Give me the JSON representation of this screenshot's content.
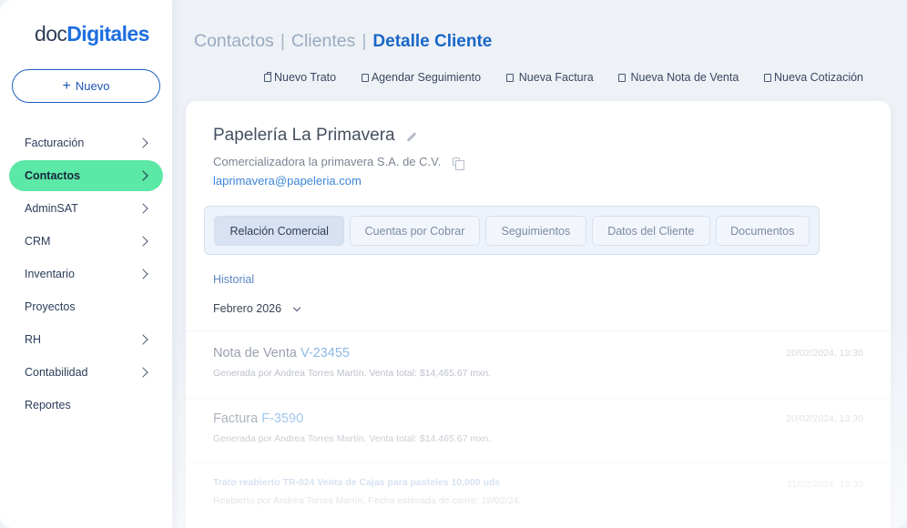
{
  "brand": {
    "part1": "doc",
    "part2": "Digitales"
  },
  "sidebar": {
    "new_button": "Nuevo",
    "items": [
      {
        "label": "Facturación",
        "has_chevron": true,
        "active": false
      },
      {
        "label": "Contactos",
        "has_chevron": true,
        "active": true
      },
      {
        "label": "AdminSAT",
        "has_chevron": true,
        "active": false
      },
      {
        "label": "CRM",
        "has_chevron": true,
        "active": false
      },
      {
        "label": "Inventario",
        "has_chevron": true,
        "active": false
      },
      {
        "label": "Proyectos",
        "has_chevron": false,
        "active": false
      },
      {
        "label": "RH",
        "has_chevron": true,
        "active": false
      },
      {
        "label": "Contabilidad",
        "has_chevron": true,
        "active": false
      },
      {
        "label": "Reportes",
        "has_chevron": false,
        "active": false
      }
    ]
  },
  "breadcrumb": {
    "level1": "Contactos",
    "level2": "Clientes",
    "current": "Detalle Cliente",
    "separator": "|"
  },
  "actions": [
    {
      "label": "Nuevo Trato",
      "icon": "briefcase-icon"
    },
    {
      "label": "Agendar Seguimiento",
      "icon": "calendar-icon"
    },
    {
      "label": "Nueva Factura",
      "icon": "invoice-icon"
    },
    {
      "label": "Nueva Nota de Venta",
      "icon": "receipt-icon"
    },
    {
      "label": "Nueva Cotización",
      "icon": "document-icon"
    }
  ],
  "client": {
    "name": "Papelería La Primavera",
    "legal_name": "Comercializadora la primavera S.A. de C.V.",
    "email": "laprimavera@papeleria.com"
  },
  "tabs": [
    {
      "label": "Relación Comercial",
      "active": true
    },
    {
      "label": "Cuentas por Cobrar",
      "active": false
    },
    {
      "label": "Seguimientos",
      "active": false
    },
    {
      "label": "Datos del Cliente",
      "active": false
    },
    {
      "label": "Documentos",
      "active": false
    }
  ],
  "history": {
    "title": "Historial",
    "month": "Febrero 2026",
    "entries": [
      {
        "type_label": "Nota de Venta",
        "ref": "V-23455",
        "detail": "Generada por Andrea Torres Martín. Venta total: $14,465.67 mxn.",
        "time": "20/02/2024, 13:30"
      },
      {
        "type_label": "Factura",
        "ref": "F-3590",
        "detail": "Generada por Andrea Torres Martín. Venta total: $14,465.67 mxn.",
        "time": "20/02/2024, 13:30"
      },
      {
        "type_label": "Trato reabierto",
        "ref": "TR-024 Venta de Cajas para pasteles 10,000 uds",
        "detail": "Reabierto por Andrea Torres Martín. Fecha estimada de cierre: 18/02/24.",
        "time": "11/02/2024, 13:30"
      }
    ]
  }
}
